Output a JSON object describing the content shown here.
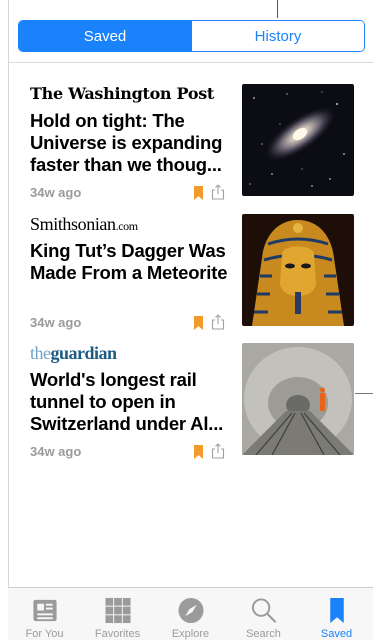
{
  "segmented": {
    "saved": "Saved",
    "history": "History"
  },
  "articles": [
    {
      "publisher": "The Washington Post",
      "headline": "Hold on tight: The Universe is expanding faster than we thoug...",
      "age": "34w ago"
    },
    {
      "publisher": "Smithsonian",
      "publisher_domain": ".com",
      "headline": "King Tut’s Dagger Was Made From a Meteorite",
      "age": "34w ago"
    },
    {
      "publisher_prefix": "the",
      "publisher": "guardian",
      "headline": "World's longest rail tunnel to open in Switzerland under Al...",
      "age": "34w ago"
    }
  ],
  "tabs": [
    {
      "label": "For You",
      "icon": "newspaper-icon"
    },
    {
      "label": "Favorites",
      "icon": "grid-icon"
    },
    {
      "label": "Explore",
      "icon": "compass-icon"
    },
    {
      "label": "Search",
      "icon": "magnifier-icon"
    },
    {
      "label": "Saved",
      "icon": "bookmark-icon",
      "active": true
    }
  ],
  "colors": {
    "accent": "#1a82fb",
    "bookmark": "#f39a2b",
    "muted": "#9a9a9a"
  }
}
